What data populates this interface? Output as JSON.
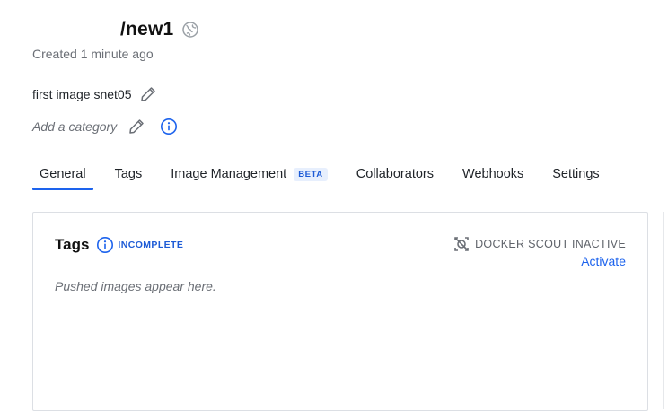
{
  "repo": {
    "name": "/new1",
    "visibility_icon": "globe-icon",
    "created": "Created 1 minute ago",
    "description": "first image snet05",
    "category_placeholder": "Add a category"
  },
  "tabs": [
    {
      "label": "General",
      "active": true
    },
    {
      "label": "Tags"
    },
    {
      "label": "Image Management",
      "badge": "BETA"
    },
    {
      "label": "Collaborators"
    },
    {
      "label": "Webhooks"
    },
    {
      "label": "Settings"
    }
  ],
  "tags_card": {
    "title": "Tags",
    "status": "INCOMPLETE",
    "scout_status": "DOCKER SCOUT INACTIVE",
    "activate_label": "Activate",
    "empty_text": "Pushed images appear here."
  },
  "colors": {
    "accent": "#1d63ed",
    "muted_text": "#6b6f76",
    "border": "#dcdfe4"
  }
}
